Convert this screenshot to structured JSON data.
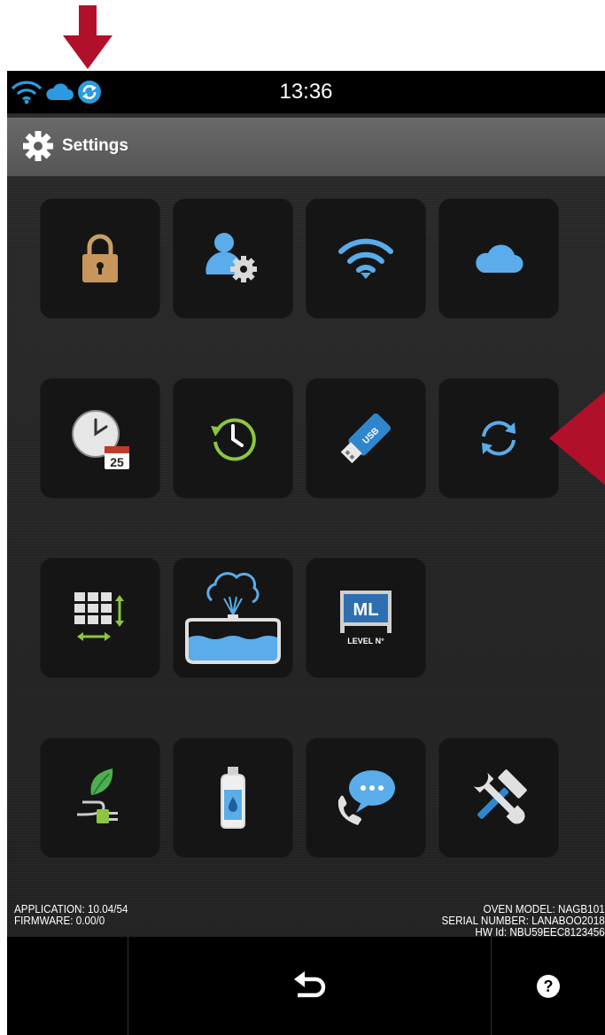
{
  "status_bar": {
    "time": "13:36",
    "icons": [
      "wifi-icon",
      "cloud-icon",
      "sync-icon"
    ]
  },
  "header": {
    "title": "Settings",
    "icon": "gear-icon"
  },
  "tiles": [
    {
      "name": "lock",
      "icon": "padlock-icon"
    },
    {
      "name": "user-settings",
      "icon": "user-gear-icon"
    },
    {
      "name": "wifi",
      "icon": "wifi-icon"
    },
    {
      "name": "cloud",
      "icon": "cloud-icon"
    },
    {
      "name": "date-time",
      "icon": "clock-calendar-icon",
      "calendar_day": "25"
    },
    {
      "name": "history",
      "icon": "history-clock-icon"
    },
    {
      "name": "usb",
      "icon": "usb-drive-icon",
      "usb_label": "USB"
    },
    {
      "name": "sync",
      "icon": "sync-icon"
    },
    {
      "name": "keypad-size",
      "icon": "grid-resize-icon"
    },
    {
      "name": "water-tank",
      "icon": "water-steam-icon"
    },
    {
      "name": "menu-level",
      "icon": "ml-level-icon",
      "ml_label": "ML",
      "level_label": "LEVEL N°"
    },
    {
      "name": "energy-saving",
      "icon": "leaf-plug-icon"
    },
    {
      "name": "detergent",
      "icon": "water-bottle-icon"
    },
    {
      "name": "support",
      "icon": "phone-chat-icon"
    },
    {
      "name": "tools",
      "icon": "hammer-wrench-icon"
    }
  ],
  "info": {
    "application": "APPLICATION: 10.04/54",
    "firmware": "FIRMWARE: 0.00/0",
    "oven_model": "OVEN MODEL: NAGB101",
    "serial_number": "SERIAL NUMBER: LANABOO2018",
    "hw_id": "HW Id: NBU59EEC8123456"
  },
  "nav": {
    "back_icon": "back-arrow-icon",
    "help_icon": "help-icon"
  },
  "annotations": {
    "color": "#b0102a"
  }
}
